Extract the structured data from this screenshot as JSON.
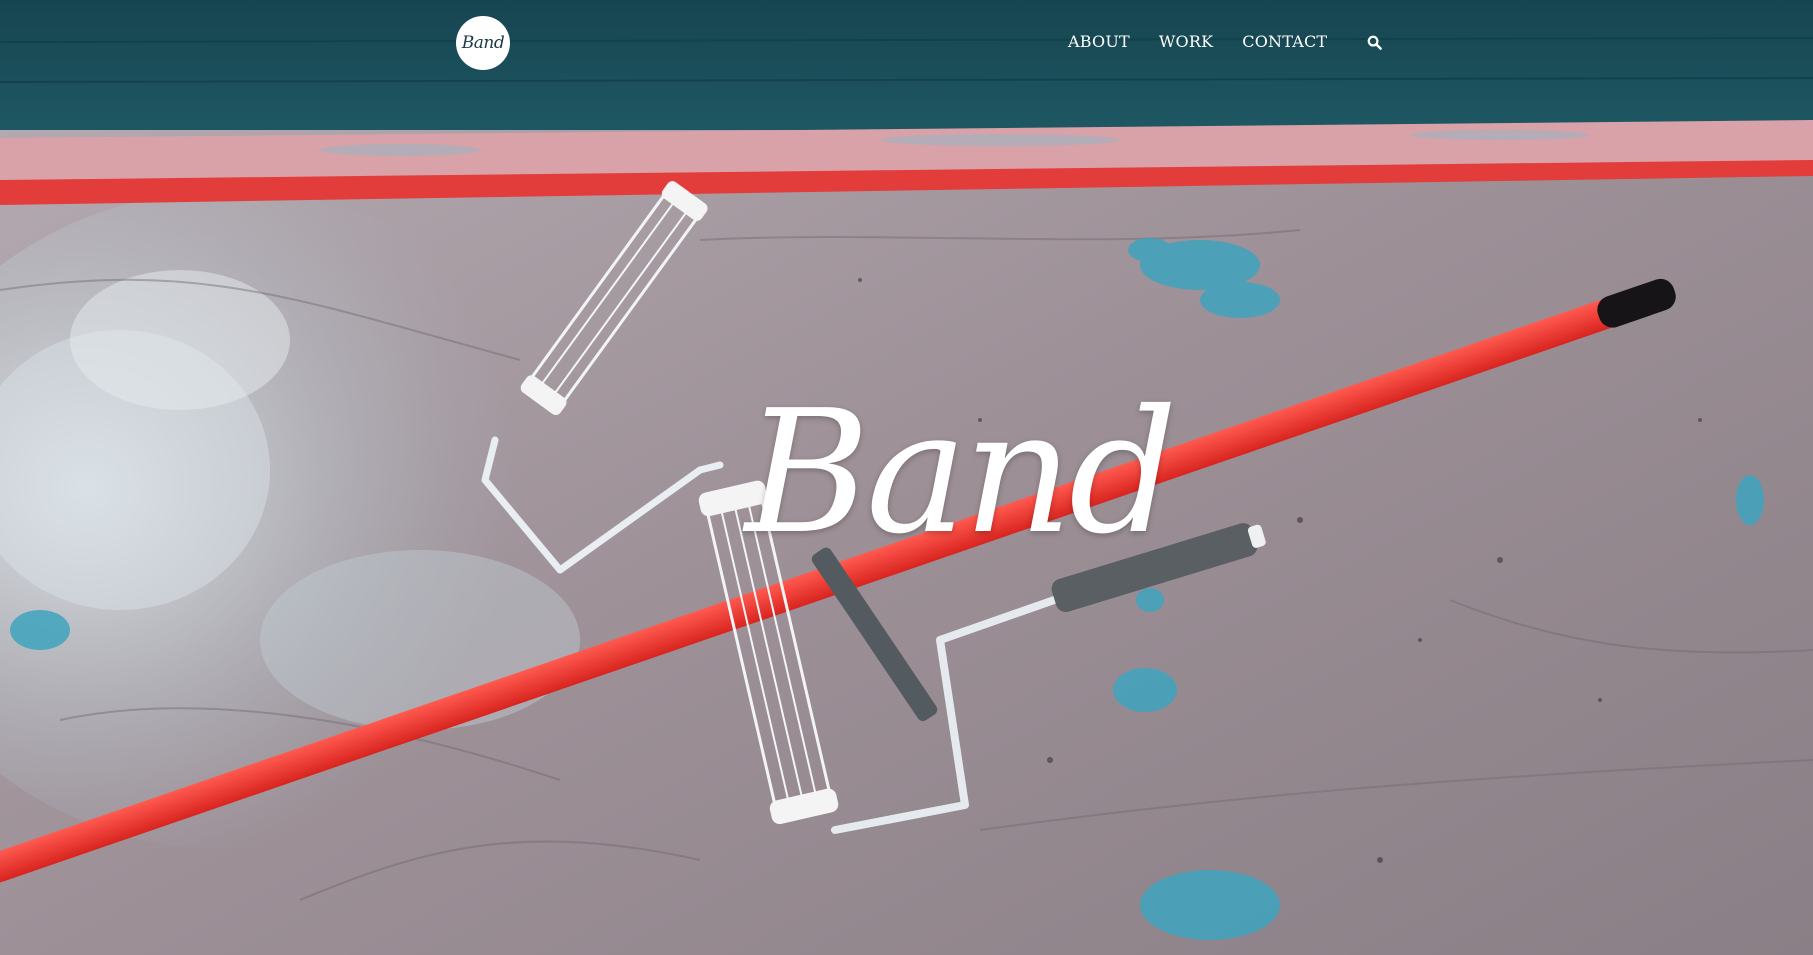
{
  "header": {
    "logo_text": "Band",
    "nav": [
      {
        "label": "ABOUT"
      },
      {
        "label": "WORK"
      },
      {
        "label": "CONTACT"
      }
    ],
    "search_icon": "search-icon"
  },
  "hero": {
    "title": "Band",
    "background": "photo of paint rollers and red extension pole on a paint-splattered drop cloth"
  },
  "colors": {
    "header_bg": "#184b57",
    "nav_text": "#ffffff",
    "pole_red": "#e8322f",
    "drop_cloth": "#9f9299",
    "paint_blue": "#3fa7c2"
  }
}
